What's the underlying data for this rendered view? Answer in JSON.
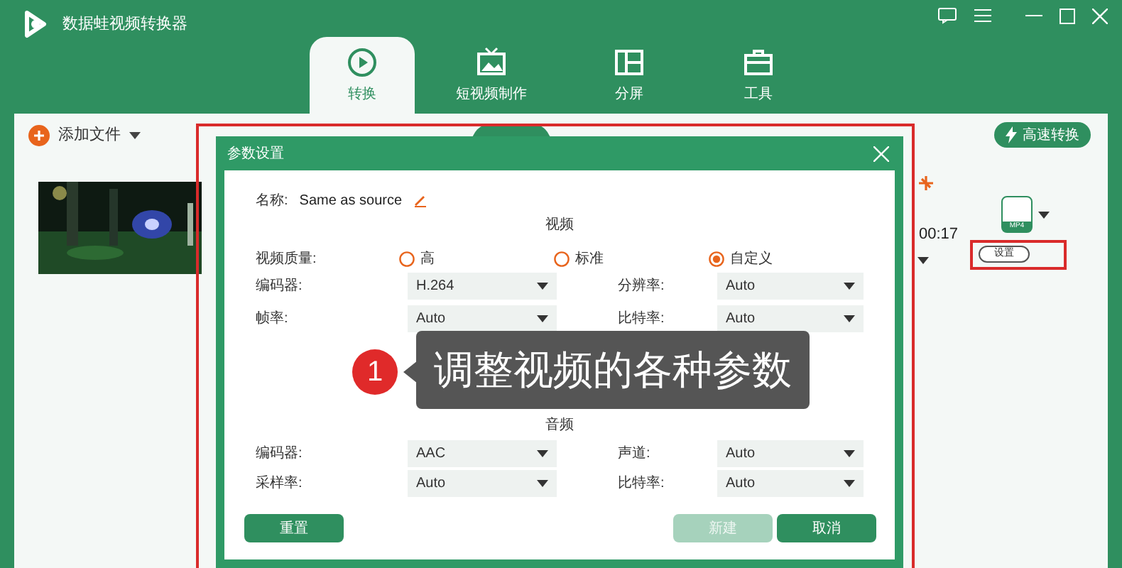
{
  "window": {
    "title": "数据蛙视频转换器"
  },
  "tabs": [
    {
      "label": "转换",
      "selected": true
    },
    {
      "label": "短视频制作",
      "selected": false
    },
    {
      "label": "分屏",
      "selected": false
    },
    {
      "label": "工具",
      "selected": false
    }
  ],
  "toolbar": {
    "add_file": "添加文件",
    "fast_convert": "高速转换"
  },
  "file": {
    "duration": "00:17",
    "format": "MP4",
    "settings_button": "设置"
  },
  "dialog": {
    "title": "参数设置",
    "name_label": "名称:",
    "name_value": "Same as source",
    "video_heading": "视频",
    "quality_label": "视频质量:",
    "quality_options": [
      {
        "label": "高",
        "selected": false
      },
      {
        "label": "标准",
        "selected": false
      },
      {
        "label": "自定义",
        "selected": true
      }
    ],
    "video_fields": [
      {
        "label": "编码器:",
        "value": "H.264"
      },
      {
        "label": "分辨率:",
        "value": "Auto"
      },
      {
        "label": "帧率:",
        "value": "Auto"
      },
      {
        "label": "比特率:",
        "value": "Auto"
      }
    ],
    "audio_heading": "音频",
    "audio_fields": [
      {
        "label": "编码器:",
        "value": "AAC"
      },
      {
        "label": "声道:",
        "value": "Auto"
      },
      {
        "label": "采样率:",
        "value": "Auto"
      },
      {
        "label": "比特率:",
        "value": "Auto"
      }
    ],
    "buttons": [
      {
        "label": "重置",
        "disabled": false
      },
      {
        "label": "新建",
        "disabled": true
      },
      {
        "label": "取消",
        "disabled": false
      }
    ]
  },
  "callout": {
    "number": "1",
    "text": "调整视频的各种参数"
  }
}
